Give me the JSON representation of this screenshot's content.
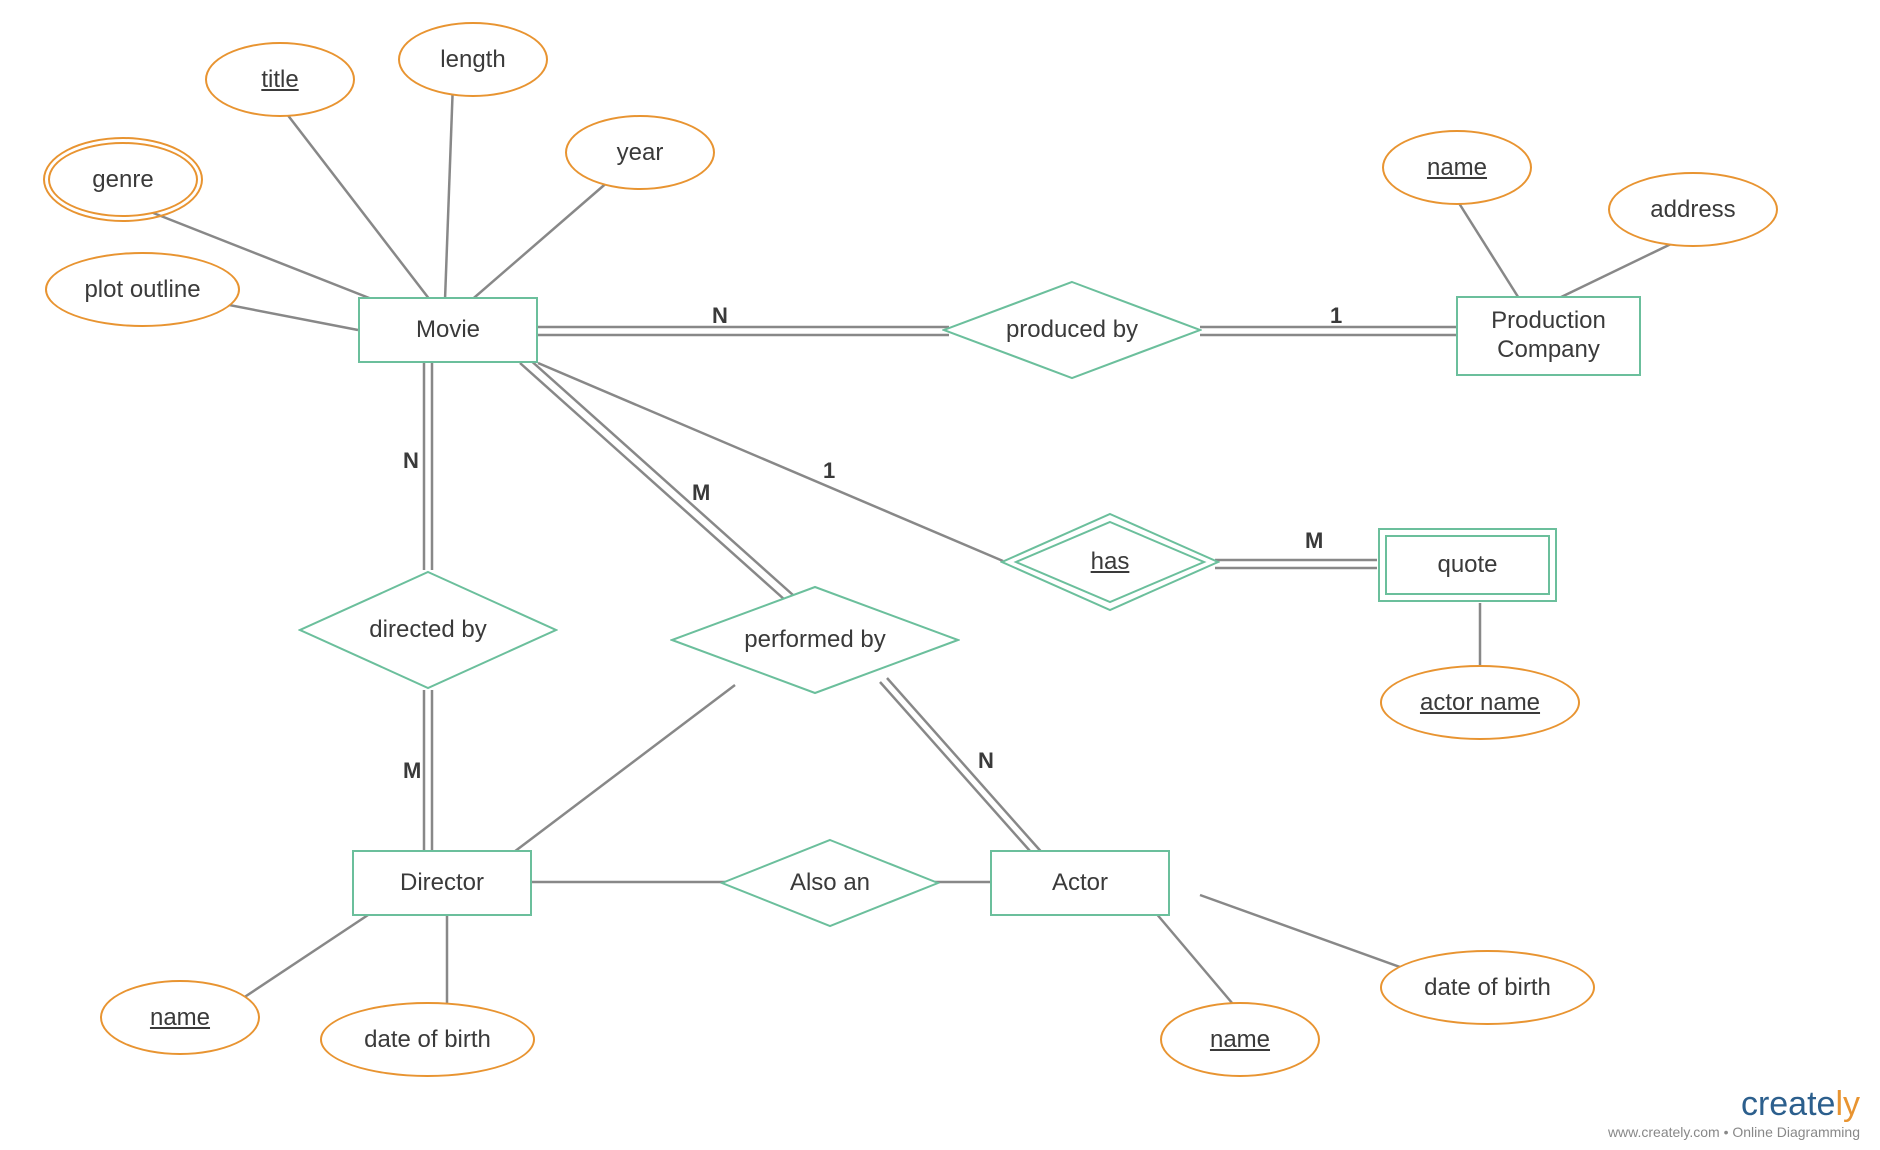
{
  "entities": {
    "movie": "Movie",
    "production_company": "Production Company",
    "director": "Director",
    "actor": "Actor",
    "quote": "quote"
  },
  "attributes": {
    "genre": "genre",
    "title": "title",
    "length": "length",
    "year": "year",
    "plot_outline": "plot outline",
    "pc_name": "name",
    "pc_address": "address",
    "quote_actor_name": "actor name",
    "director_name": "name",
    "director_dob": "date of birth",
    "actor_name": "name",
    "actor_dob": "date of birth"
  },
  "relationships": {
    "produced_by": "produced by",
    "has": "has",
    "directed_by": "directed by",
    "performed_by": "performed by",
    "also_an": "Also an"
  },
  "cardinalities": {
    "movie_produced_n": "N",
    "pc_produced_1": "1",
    "movie_has_1": "1",
    "quote_has_m": "M",
    "movie_directed_n": "N",
    "director_directed_m": "M",
    "movie_performed_m": "M",
    "actor_performed_n": "N"
  },
  "watermark": {
    "brand_1": "create",
    "brand_2": "ly",
    "tagline": "www.creately.com • Online Diagramming"
  }
}
